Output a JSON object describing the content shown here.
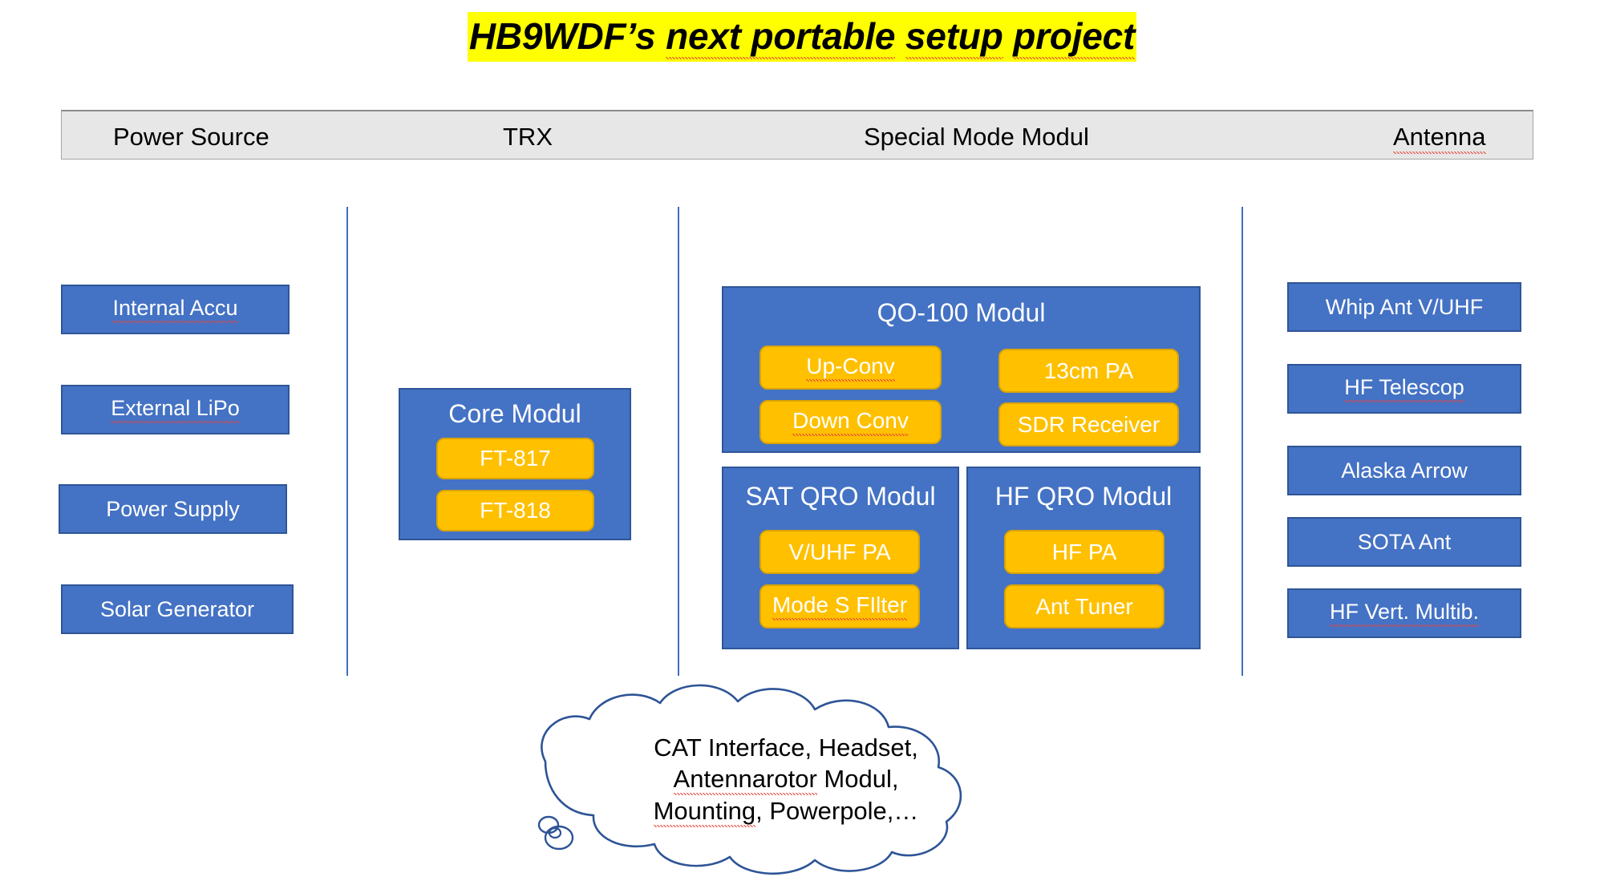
{
  "title": {
    "part1": "HB9WDF’s ",
    "part2": "next portable",
    "part3": " ",
    "part4": "setup",
    "part5": " ",
    "part6": "project",
    "full": "HB9WDF’s next portable setup project",
    "highlight_color": "#FFFF00"
  },
  "header": {
    "items": [
      {
        "label": "Power Source"
      },
      {
        "label": "TRX"
      },
      {
        "label": "Special Mode Modul"
      },
      {
        "label": "Antenna"
      }
    ],
    "background": "#E7E7E7"
  },
  "colors": {
    "blue_fill": "#4472C4",
    "blue_border": "#2F5597",
    "gold_fill": "#FFC000",
    "gold_border": "#D9A400",
    "divider": "#3E6DC0",
    "cloud_stroke": "#2E5496"
  },
  "power_source": {
    "boxes": [
      {
        "label": "Internal Accu"
      },
      {
        "label": "External LiPo"
      },
      {
        "label": "Power Supply"
      },
      {
        "label": "Solar Generator"
      }
    ]
  },
  "trx": {
    "core_module": {
      "title": "Core Modul",
      "items": [
        {
          "label": "FT-817"
        },
        {
          "label": "FT-818"
        }
      ]
    }
  },
  "special_mode": {
    "qo100": {
      "title": "QO-100 Modul",
      "items": [
        {
          "label": "Up-Conv"
        },
        {
          "label": "Down Conv"
        },
        {
          "label": "13cm PA"
        },
        {
          "label": "SDR Receiver"
        }
      ]
    },
    "sat_qro": {
      "title": "SAT QRO Modul",
      "items": [
        {
          "label": "V/UHF PA"
        },
        {
          "label": "Mode S FIlter"
        }
      ]
    },
    "hf_qro": {
      "title": "HF QRO Modul",
      "items": [
        {
          "label": "HF PA"
        },
        {
          "label": "Ant Tuner"
        }
      ]
    }
  },
  "antenna": {
    "boxes": [
      {
        "label": "Whip Ant V/UHF"
      },
      {
        "label": "HF Telescop"
      },
      {
        "label": "Alaska Arrow"
      },
      {
        "label": "SOTA Ant"
      },
      {
        "label": "HF Vert. Multib."
      }
    ]
  },
  "cloud": {
    "line1": "CAT Interface, Headset,",
    "line2_a": "Antennarotor",
    "line2_b": " Modul,",
    "line3_a": "Mounting",
    "line3_b": ", Powerpole,…"
  }
}
